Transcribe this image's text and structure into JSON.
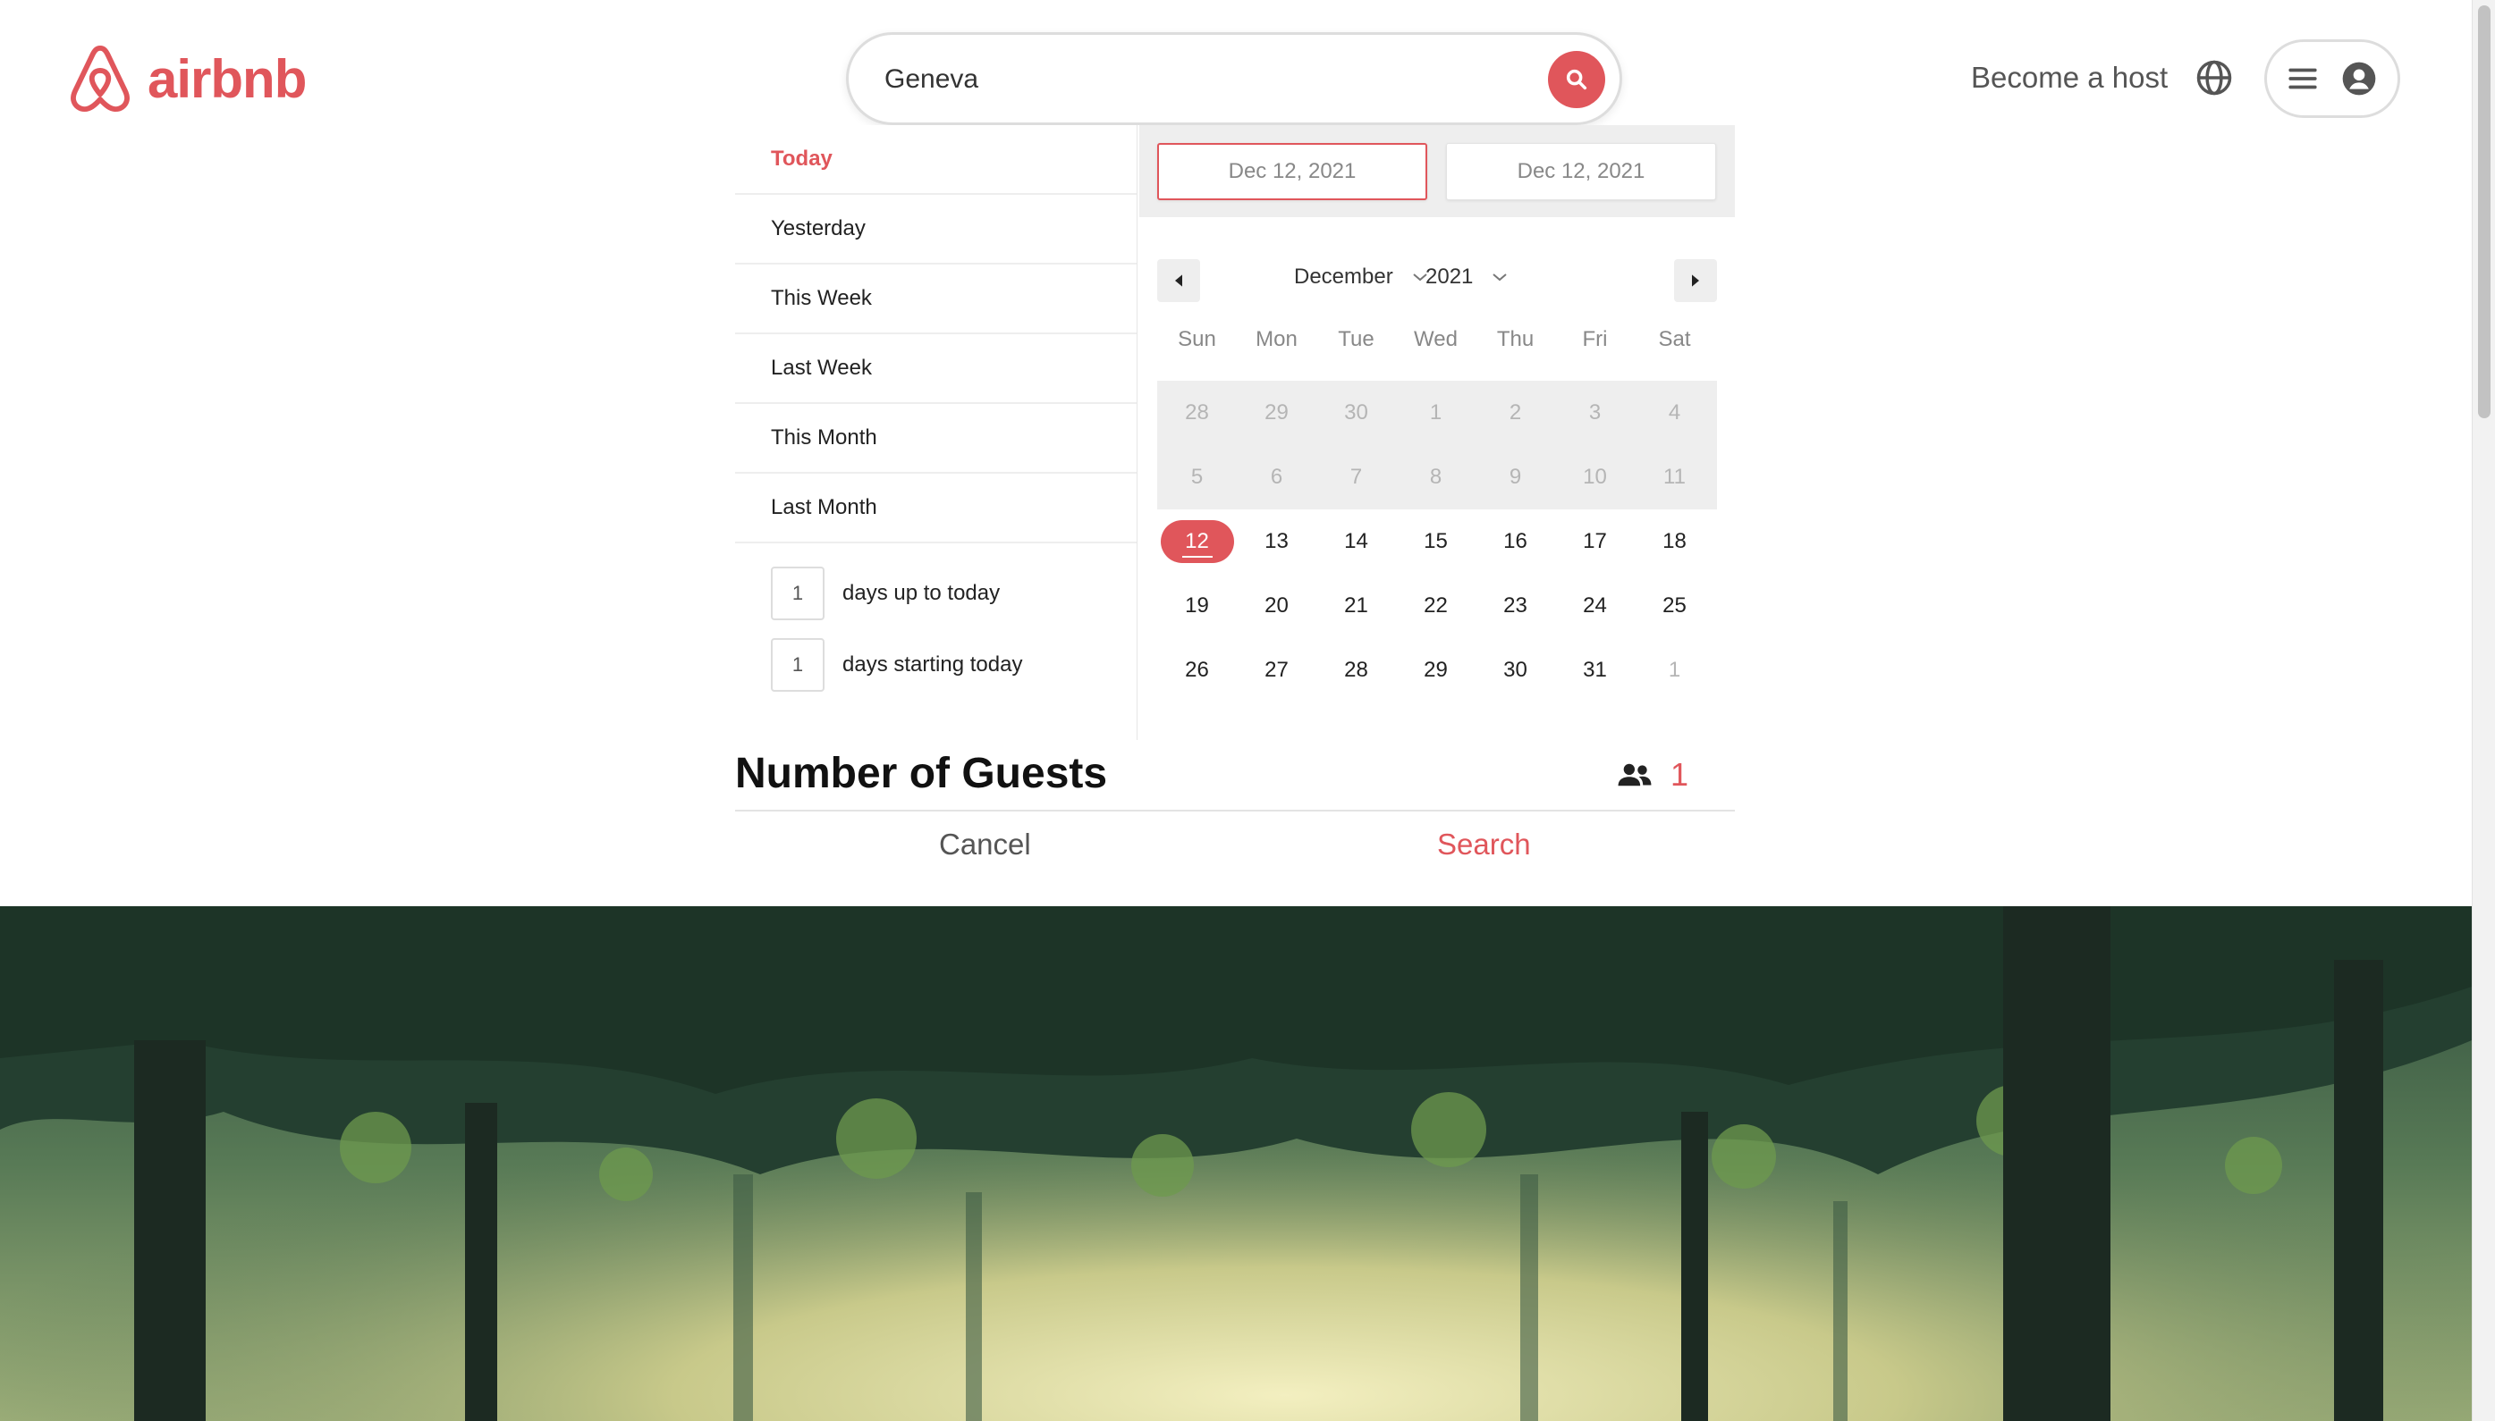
{
  "brand": {
    "name": "airbnb",
    "accent": "#e0565b"
  },
  "search": {
    "value": "Geneva",
    "icon": "search-icon"
  },
  "header": {
    "host_link": "Become a host",
    "globe_icon": "globe-icon",
    "menu_icon": "hamburger-icon",
    "profile_icon": "user-avatar-icon"
  },
  "date_ranges": [
    {
      "label": "Today",
      "active": true
    },
    {
      "label": "Yesterday"
    },
    {
      "label": "This Week"
    },
    {
      "label": "Last Week"
    },
    {
      "label": "This Month"
    },
    {
      "label": "Last Month"
    }
  ],
  "relative_days": [
    {
      "value": "1",
      "label": "days up to today"
    },
    {
      "value": "1",
      "label": "days starting today"
    }
  ],
  "date_inputs": {
    "start": "Dec 12, 2021",
    "end": "Dec 12, 2021"
  },
  "calendar": {
    "month": "December",
    "year": "2021",
    "weekdays": [
      "Sun",
      "Mon",
      "Tue",
      "Wed",
      "Thu",
      "Fri",
      "Sat"
    ],
    "weeks": [
      [
        "28",
        "29",
        "30",
        "1",
        "2",
        "3",
        "4"
      ],
      [
        "5",
        "6",
        "7",
        "8",
        "9",
        "10",
        "11"
      ],
      [
        "12",
        "13",
        "14",
        "15",
        "16",
        "17",
        "18"
      ],
      [
        "19",
        "20",
        "21",
        "22",
        "23",
        "24",
        "25"
      ],
      [
        "26",
        "27",
        "28",
        "29",
        "30",
        "31",
        "1"
      ]
    ],
    "selected": "12"
  },
  "guests": {
    "title": "Number of Guests",
    "count": "1",
    "icon": "people-icon"
  },
  "actions": {
    "cancel": "Cancel",
    "search": "Search"
  },
  "hero": {
    "description_icon": "forest-hero-image"
  }
}
